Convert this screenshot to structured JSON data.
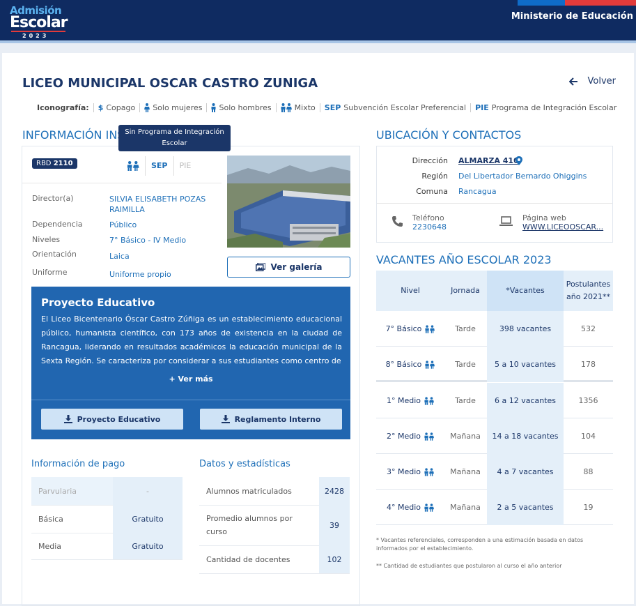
{
  "header": {
    "logo_line1": "Admisión",
    "logo_line2": "Escolar",
    "logo_year": "2023",
    "ministry": "Ministerio de Educación"
  },
  "school": {
    "name": "LICEO MUNICIPAL OSCAR CASTRO ZUNIGA",
    "back_label": "Volver"
  },
  "iconography": {
    "label": "Iconografía:",
    "items": [
      {
        "icon": "dollar-icon",
        "text": "Copago"
      },
      {
        "icon": "female-icon",
        "text": "Solo mujeres"
      },
      {
        "icon": "male-icon",
        "text": "Solo hombres"
      },
      {
        "icon": "mixed-icon",
        "text": "Mixto"
      },
      {
        "abbr": "SEP",
        "text": "Subvención Escolar Preferencial"
      },
      {
        "abbr": "PIE",
        "text": "Programa de Integración Escolar"
      }
    ]
  },
  "info_section": {
    "title": "INFORMACIÓN INSTITUCIONAL",
    "tooltip": "Sin Programa de Integración Escolar",
    "rbd_label": "RBD",
    "rbd_value": "2110",
    "chip_sep": "SEP",
    "chip_pie": "PIE",
    "fields": [
      {
        "key": "Director(a)",
        "value": "SILVIA ELISABETH POZAS RAIMILLA"
      },
      {
        "key": "Dependencia",
        "value": "Público"
      },
      {
        "key": "Niveles",
        "value": "7° Básico - IV Medio"
      },
      {
        "key": "Orientación",
        "value": "Laica"
      },
      {
        "key": "Uniforme",
        "value": "Uniforme propio"
      }
    ],
    "gallery_button": "Ver galería"
  },
  "proyecto": {
    "title": "Proyecto Educativo",
    "text": "El Liceo Bicentenario Óscar Castro Zúñiga es un establecimiento educacional público, humanista científico, con 173 años de existencia en la ciudad de Rancagua, liderando en resultados académicos la educación municipal de la Sexta Región. Se caracteriza por considerar a sus estudiantes como centro de",
    "more": "+ Ver más",
    "btn_proyecto": "Proyecto Educativo",
    "btn_reglamento": "Reglamento Interno"
  },
  "pago": {
    "title": "Información de pago",
    "rows": [
      {
        "level": "Parvularia",
        "value": "-"
      },
      {
        "level": "Básica",
        "value": "Gratuito"
      },
      {
        "level": "Media",
        "value": "Gratuito"
      }
    ]
  },
  "datos": {
    "title": "Datos y estadísticas",
    "rows": [
      {
        "label": "Alumnos matriculados",
        "value": "2428"
      },
      {
        "label": "Promedio alumnos por curso",
        "value": "39"
      },
      {
        "label": "Cantidad de docentes",
        "value": "102"
      }
    ]
  },
  "ubicacion": {
    "title": "UBICACIÓN Y CONTACTOS",
    "direccion_label": "Dirección",
    "direccion": "ALMARZA 410",
    "region_label": "Región",
    "region": "Del Libertador Bernardo Ohiggins",
    "comuna_label": "Comuna",
    "comuna": "Rancagua",
    "telefono_label": "Teléfono",
    "telefono": "2230648",
    "web_label": "Página web",
    "web": "WWW.LICEOOSCAR..."
  },
  "vacantes": {
    "title": "VACANTES AÑO ESCOLAR 2023",
    "headers": [
      "Nivel",
      "Jornada",
      "*Vacantes",
      "Postulantes año 2021**"
    ],
    "rows": [
      {
        "nivel": "7° Básico",
        "jornada": "Tarde",
        "vacantes": "398 vacantes",
        "postulantes": "532"
      },
      {
        "nivel": "8° Básico",
        "jornada": "Tarde",
        "vacantes": "5 a 10 vacantes",
        "postulantes": "178"
      },
      {
        "nivel": "1° Medio",
        "jornada": "Tarde",
        "vacantes": "6 a 12 vacantes",
        "postulantes": "1356"
      },
      {
        "nivel": "2° Medio",
        "jornada": "Mañana",
        "vacantes": "14 a 18 vacantes",
        "postulantes": "104"
      },
      {
        "nivel": "3° Medio",
        "jornada": "Mañana",
        "vacantes": "4 a 7 vacantes",
        "postulantes": "88"
      },
      {
        "nivel": "4° Medio",
        "jornada": "Mañana",
        "vacantes": "2 a 5 vacantes",
        "postulantes": "19"
      }
    ],
    "note1": "* Vacantes referenciales, corresponden a una estimación basada en datos informados por el establecimiento.",
    "note2": "** Cantidad de estudiantes que postularon al curso el año anterior"
  }
}
